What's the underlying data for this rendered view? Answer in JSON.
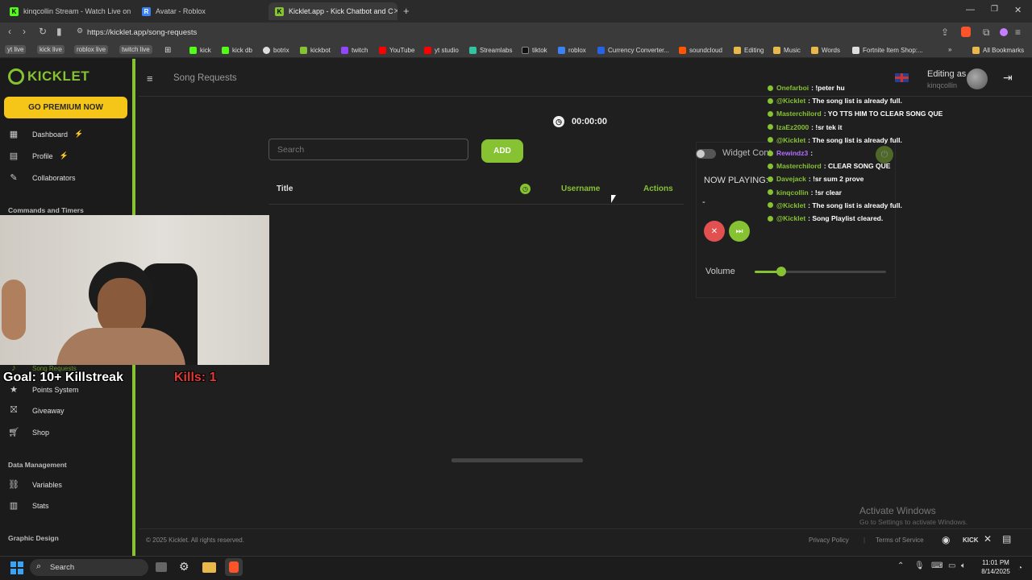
{
  "tabs": [
    {
      "title": "kinqcollin Stream - Watch Live on Ki",
      "color": "#53fc18",
      "glyph": "K"
    },
    {
      "title": "Avatar - Roblox",
      "color": "#3b82f6",
      "glyph": "R"
    },
    {
      "title": "Kicklet.app - Kick Chatbot and C",
      "color": "#86c232",
      "glyph": "K"
    }
  ],
  "browser": {
    "url": "https://kicklet.app/song-requests",
    "new_tab": "+"
  },
  "bookmarks": [
    {
      "label": "yt live"
    },
    {
      "label": "kick live"
    },
    {
      "label": "roblox live"
    },
    {
      "label": "twitch live"
    },
    {
      "label": "kick"
    },
    {
      "label": "kick db"
    },
    {
      "label": "botrix"
    },
    {
      "label": "kickbot"
    },
    {
      "label": "twitch"
    },
    {
      "label": "YouTube"
    },
    {
      "label": "yt studio"
    },
    {
      "label": "Streamlabs"
    },
    {
      "label": "tiktok"
    },
    {
      "label": "roblox"
    },
    {
      "label": "Currency Converter..."
    },
    {
      "label": "soundcloud"
    },
    {
      "label": "Editing"
    },
    {
      "label": "Music"
    },
    {
      "label": "Words"
    },
    {
      "label": "Fortnite Item Shop:..."
    },
    {
      "label": "All Bookmarks"
    }
  ],
  "app": {
    "logo": "KICKLET",
    "premium": "GO PREMIUM NOW",
    "nav_top": [
      "Dashboard",
      "Profile",
      "Collaborators"
    ],
    "section_commands": "Commands and Timers",
    "nav_song": "Song Requests",
    "nav_mid": [
      "Points System",
      "Giveaway",
      "Shop"
    ],
    "section_data": "Data Management",
    "nav_data": [
      "Variables",
      "Stats"
    ],
    "section_graphic": "Graphic Design",
    "page_title": "Song Requests",
    "timer": "00:00:00",
    "search_placeholder": "Search",
    "add_label": "ADD",
    "table": {
      "title": "Title",
      "username": "Username",
      "actions": "Actions"
    },
    "widget_label": "Widget Cont",
    "now_playing": "NOW PLAYING:",
    "now_playing_value": "-",
    "volume_label": "Volume",
    "volume_level": 0.2,
    "editing_as": "Editing as",
    "editing_user": "kinqcollin",
    "copyright": "© 2025 Kicklet. All rights reserved.",
    "privacy": "Privacy Policy",
    "terms": "Terms of Service"
  },
  "chat": [
    {
      "user": "Onefarboi",
      "msg": ": !peter hu",
      "ucolor": "#86c232"
    },
    {
      "user": "@Kicklet",
      "msg": ": The song list is already full.",
      "ucolor": "#86c232"
    },
    {
      "user": "Masterchilord",
      "msg": ": YO TTS HIM TO CLEAR SONG QUE",
      "ucolor": "#86c232"
    },
    {
      "user": "IzaEz2000",
      "msg": ": !sr tek it",
      "ucolor": "#86c232"
    },
    {
      "user": "@Kicklet",
      "msg": ": The song list is already full.",
      "ucolor": "#86c232"
    },
    {
      "user": "Rewindz3",
      "msg": ":",
      "ucolor": "#b26cff"
    },
    {
      "user": "Masterchilord",
      "msg": ": CLEAR SONG QUE",
      "ucolor": "#86c232"
    },
    {
      "user": "Davejack",
      "msg": ": !sr sum 2 prove",
      "ucolor": "#86c232"
    },
    {
      "user": "kinqcollin",
      "msg": ": !sr clear",
      "ucolor": "#86c232"
    },
    {
      "user": "@Kicklet",
      "msg": ": The song list is already full.",
      "ucolor": "#86c232"
    },
    {
      "user": "@Kicklet",
      "msg": ": Song Playlist cleared.",
      "ucolor": "#86c232"
    }
  ],
  "overlay": {
    "goal": "Goal: 10+ Killstreak",
    "kills": "Kills: 1"
  },
  "windows": {
    "activate": "Activate Windows",
    "activate_sub": "Go to Settings to activate Windows.",
    "search": "Search",
    "time": "11:01 PM",
    "date": "8/14/2025"
  },
  "colors": {
    "accent": "#86c232",
    "premium": "#f5c518",
    "danger": "#e35050"
  }
}
